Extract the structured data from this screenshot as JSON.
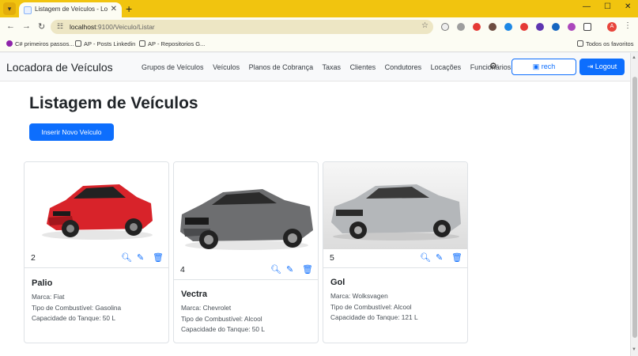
{
  "browser": {
    "tab_title": "Listagem de Veículos - Locadora de Veículos",
    "new_tab": "+",
    "url_host": "localhost",
    "url_path": ":9100/Veiculo/Listar",
    "bookmarks": [
      {
        "label": "C# primeiros passos...",
        "icon": "bookmark-icon",
        "color": "#8e24aa"
      },
      {
        "label": "AP - Posts Linkedin",
        "icon": "folder-icon",
        "color": "#555555"
      },
      {
        "label": "AP - Repositorios G...",
        "icon": "folder-icon",
        "color": "#555555"
      }
    ],
    "all_bookmarks": "Todos os favoritos",
    "avatar_letter": "A"
  },
  "navbar": {
    "brand": "Locadora de Veículos",
    "links": [
      "Grupos de Veículos",
      "Veículos",
      "Planos de Cobrança",
      "Taxas",
      "Clientes",
      "Condutores",
      "Locações",
      "Funcionários"
    ],
    "user_label": "rech",
    "logout_label": "Logout"
  },
  "page": {
    "title": "Listagem de Veículos",
    "insert_button": "Inserir Novo Veículo"
  },
  "vehicles": [
    {
      "id": "2",
      "modelo": "Palio",
      "marca": "Marca: Fiat",
      "combustivel": "Tipo de Combustível: Gasolina",
      "tanque": "Capacidade do Tanque: 50 L",
      "color": "#d8232a"
    },
    {
      "id": "4",
      "modelo": "Vectra",
      "marca": "Marca: Chevrolet",
      "combustivel": "Tipo de Combustível: Alcool",
      "tanque": "Capacidade do Tanque: 50 L",
      "color": "#6d6e70"
    },
    {
      "id": "5",
      "modelo": "Gol",
      "marca": "Marca: Wolksvagen",
      "combustivel": "Tipo de Combustível: Alcool",
      "tanque": "Capacidade do Tanque: 121 L",
      "color": "#b4b7ba"
    }
  ],
  "colors": {
    "primary": "#0d6efd",
    "chrome": "#f1c40f"
  }
}
